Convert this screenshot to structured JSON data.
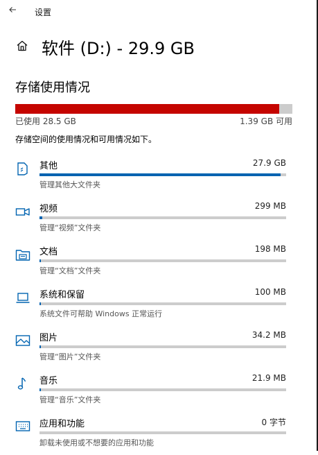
{
  "window": {
    "title": "设置"
  },
  "header": {
    "title": "软件 (D:) - 29.9 GB"
  },
  "storage": {
    "section_title": "存储使用情况",
    "used_label": "已使用 28.5 GB",
    "free_label": "1.39 GB 可用",
    "used_fraction": 0.953,
    "description": "存储空间的使用情况和可用情况如下。"
  },
  "categories": [
    {
      "name": "其他",
      "size": "27.9 GB",
      "subtitle": "管理其他大文件夹",
      "fraction": 0.978,
      "icon": "other-files-icon"
    },
    {
      "name": "视频",
      "size": "299 MB",
      "subtitle": "管理“视频”文件夹",
      "fraction": 0.01,
      "icon": "video-camera-icon"
    },
    {
      "name": "文档",
      "size": "198 MB",
      "subtitle": "管理“文档”文件夹",
      "fraction": 0.007,
      "icon": "documents-folder-icon"
    },
    {
      "name": "系统和保留",
      "size": "100 MB",
      "subtitle": "系统文件可帮助 Windows 正常运行",
      "fraction": 0.004,
      "icon": "laptop-icon"
    },
    {
      "name": "图片",
      "size": "34.2 MB",
      "subtitle": "管理“图片”文件夹",
      "fraction": 0.002,
      "icon": "picture-icon"
    },
    {
      "name": "音乐",
      "size": "21.9 MB",
      "subtitle": "管理“音乐”文件夹",
      "fraction": 0.001,
      "icon": "music-note-icon"
    },
    {
      "name": "应用和功能",
      "size": "0 字节",
      "subtitle": "卸载未使用或不想要的应用和功能",
      "fraction": 0.0,
      "icon": "apps-keyboard-icon"
    }
  ],
  "colors": {
    "used": "#c50500",
    "track": "#cccccc",
    "category_fill": "#0063b1",
    "icon": "#0063b1"
  }
}
